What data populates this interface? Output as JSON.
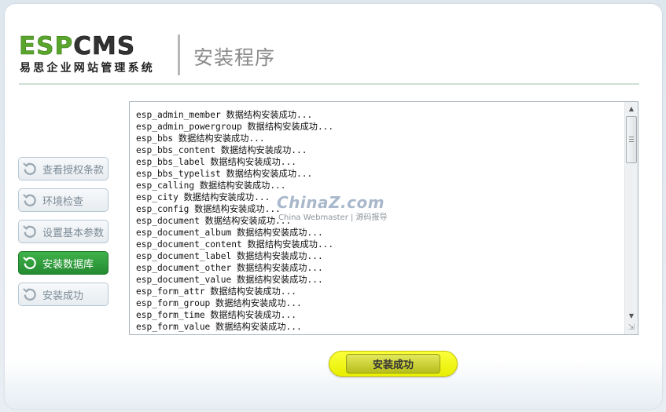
{
  "logo": {
    "brand_part1": "ESP",
    "brand_part2": "CMS",
    "subtitle": "易思企业网站管理系统"
  },
  "header": {
    "title": "安装程序"
  },
  "steps": [
    {
      "label": "查看授权条款",
      "icon": "refresh-icon",
      "active": false
    },
    {
      "label": "环境检查",
      "icon": "refresh-icon",
      "active": false
    },
    {
      "label": "设置基本参数",
      "icon": "refresh-icon",
      "active": false
    },
    {
      "label": "安装数据库",
      "icon": "refresh-icon",
      "active": true
    },
    {
      "label": "安装成功",
      "icon": "refresh-icon",
      "active": false
    }
  ],
  "log": {
    "lines": [
      "esp_admin_member 数据结构安装成功...",
      "esp_admin_powergroup 数据结构安装成功...",
      "esp_bbs 数据结构安装成功...",
      "esp_bbs_content 数据结构安装成功...",
      "esp_bbs_label 数据结构安装成功...",
      "esp_bbs_typelist 数据结构安装成功...",
      "esp_calling 数据结构安装成功...",
      "esp_city 数据结构安装成功...",
      "esp_config 数据结构安装成功...",
      "esp_document 数据结构安装成功...",
      "esp_document_album 数据结构安装成功...",
      "esp_document_content 数据结构安装成功...",
      "esp_document_label 数据结构安装成功...",
      "esp_document_other 数据结构安装成功...",
      "esp_document_value 数据结构安装成功...",
      "esp_form_attr 数据结构安装成功...",
      "esp_form_group 数据结构安装成功...",
      "esp_form_time 数据结构安装成功...",
      "esp_form_value 数据结构安装成功..."
    ]
  },
  "watermark": {
    "main": "ChinaZ.com",
    "sub": "China Webmaster | 源码报导"
  },
  "footer": {
    "finish_label": "安装成功"
  },
  "colors": {
    "brand_green": "#5aa52c",
    "active_step": "#2f9e3c",
    "finish_button": "#f2f51a"
  }
}
